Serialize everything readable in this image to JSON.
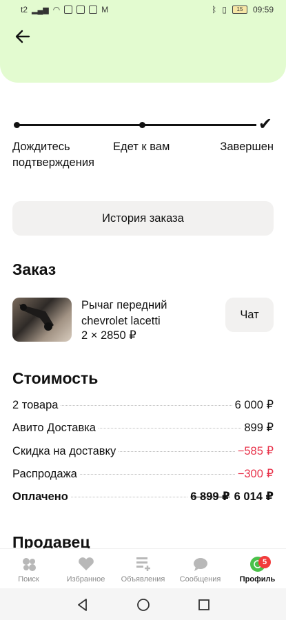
{
  "status_bar": {
    "left_text": "t2",
    "battery": "15",
    "time": "09:59"
  },
  "header": {
    "back_icon": "back-arrow-icon"
  },
  "progress": {
    "steps": [
      {
        "label": "Дождитесь подтверждения"
      },
      {
        "label": "Едет к вам"
      },
      {
        "label": "Завершен"
      }
    ],
    "done_icon": "check-icon"
  },
  "history_button": "История заказа",
  "order": {
    "title": "Заказ",
    "item": {
      "title": "Рычаг передний chevrolet lacetti",
      "price": "2 × 2850 ₽"
    },
    "chat_button": "Чат"
  },
  "cost": {
    "title": "Стоимость",
    "rows": [
      {
        "label": "2 товара",
        "value": "6 000 ₽"
      },
      {
        "label": "Авито Доставка",
        "value": "899 ₽"
      },
      {
        "label": "Скидка на доставку",
        "value": "−585 ₽"
      },
      {
        "label": "Распродажа",
        "value": "−300 ₽"
      }
    ],
    "total": {
      "label": "Оплачено",
      "old_value": "6 899 ₽",
      "value": "6 014 ₽"
    },
    "discount_color": "#e8324a"
  },
  "seller": {
    "title": "Продавец"
  },
  "bottom_nav": {
    "items": [
      {
        "label": "Поиск",
        "icon": "search-icon"
      },
      {
        "label": "Избранное",
        "icon": "heart-icon"
      },
      {
        "label": "Объявления",
        "icon": "ads-icon"
      },
      {
        "label": "Сообщения",
        "icon": "chat-icon"
      },
      {
        "label": "Профиль",
        "icon": "profile-icon",
        "badge": "5"
      }
    ]
  },
  "colors": {
    "header_bg": "#e3fbd0",
    "button_bg": "#f2f1f0",
    "discount": "#e8324a",
    "nav_inactive": "#8a8a8a"
  }
}
